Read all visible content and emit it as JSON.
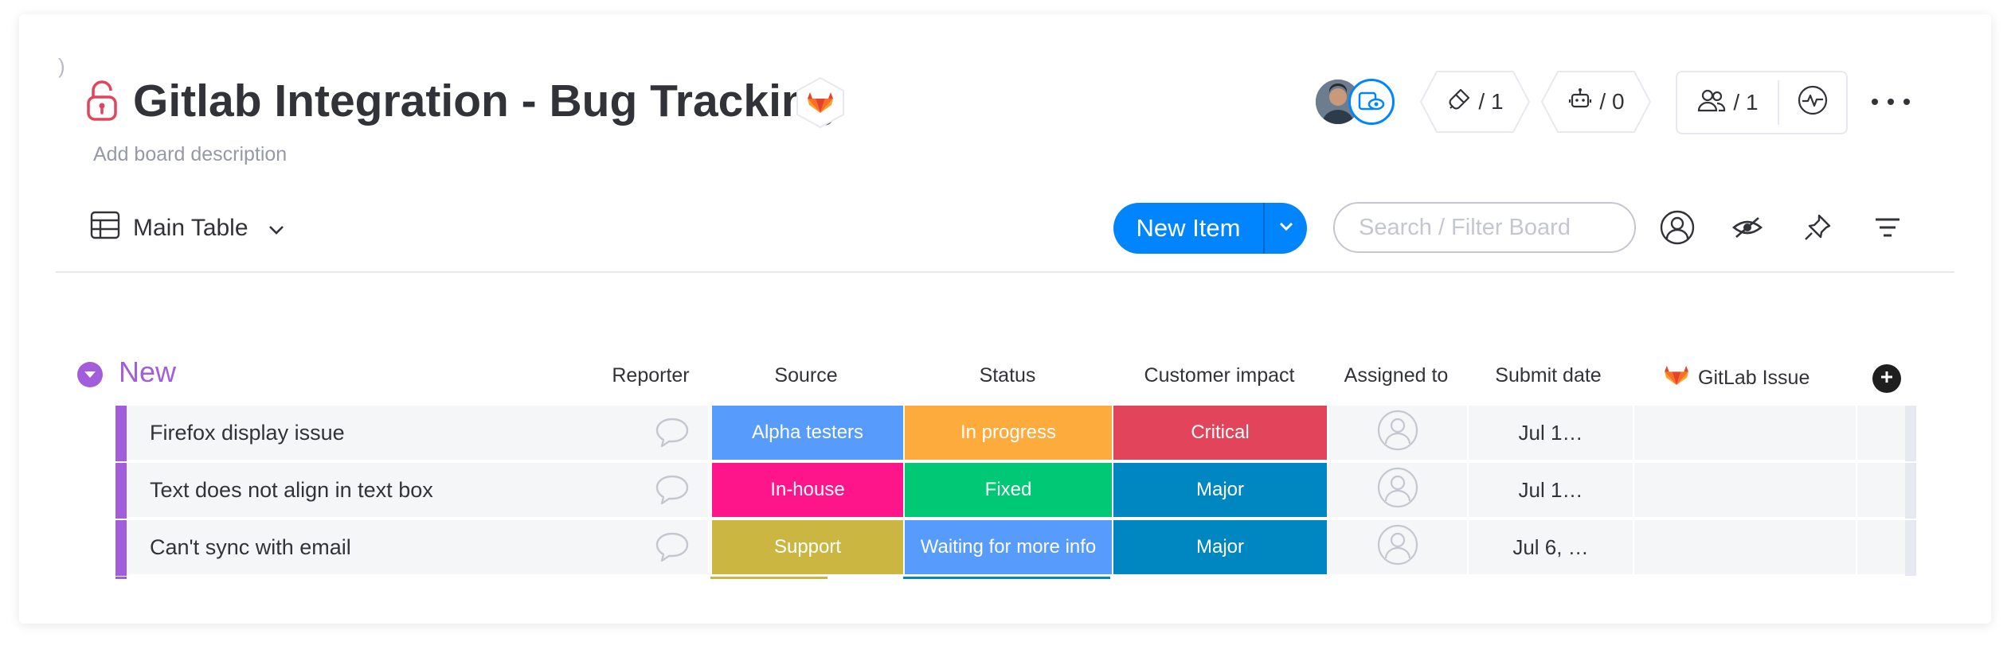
{
  "board": {
    "title": "Gitlab Integration - Bug Tracking",
    "description_placeholder": "Add board description",
    "accent_color": "#a25ddc",
    "lock_color": "#e2445c",
    "gitlab_color": "#e24329"
  },
  "header": {
    "integrations_count": "/ 1",
    "automations_count": "/ 0",
    "members_count": "/ 1",
    "icons": [
      "lock-icon",
      "gitlab-icon",
      "avatar",
      "viewer-icon",
      "integrations-icon",
      "robot-icon",
      "people-icon",
      "activity-icon",
      "more-icon"
    ]
  },
  "toolbar": {
    "view_label": "Main Table",
    "new_item_label": "New Item",
    "search_placeholder": "Search / Filter Board",
    "primary_color": "#0085ff"
  },
  "group": {
    "name": "New",
    "columns": [
      "Reporter",
      "Source",
      "Status",
      "Customer impact",
      "Assigned to",
      "Submit date",
      "GitLab Issue"
    ]
  },
  "rows": [
    {
      "item": "Firefox display issue",
      "source": {
        "label": "Alpha testers",
        "color": "#579bfc"
      },
      "status": {
        "label": "In progress",
        "color": "#fdab3d"
      },
      "impact": {
        "label": "Critical",
        "color": "#e2445c"
      },
      "submit_date": "Jul 1…"
    },
    {
      "item": "Text does not align in text box",
      "source": {
        "label": "In-house",
        "color": "#ff158a"
      },
      "status": {
        "label": "Fixed",
        "color": "#00c875"
      },
      "impact": {
        "label": "Major",
        "color": "#0086c0"
      },
      "submit_date": "Jul 1…"
    },
    {
      "item": "Can't sync with email",
      "source": {
        "label": "Support",
        "color": "#cab641"
      },
      "status": {
        "label": "Waiting for more info",
        "color": "#579bfc"
      },
      "impact": {
        "label": "Major",
        "color": "#0086c0"
      },
      "submit_date": "Jul 6, …"
    }
  ]
}
